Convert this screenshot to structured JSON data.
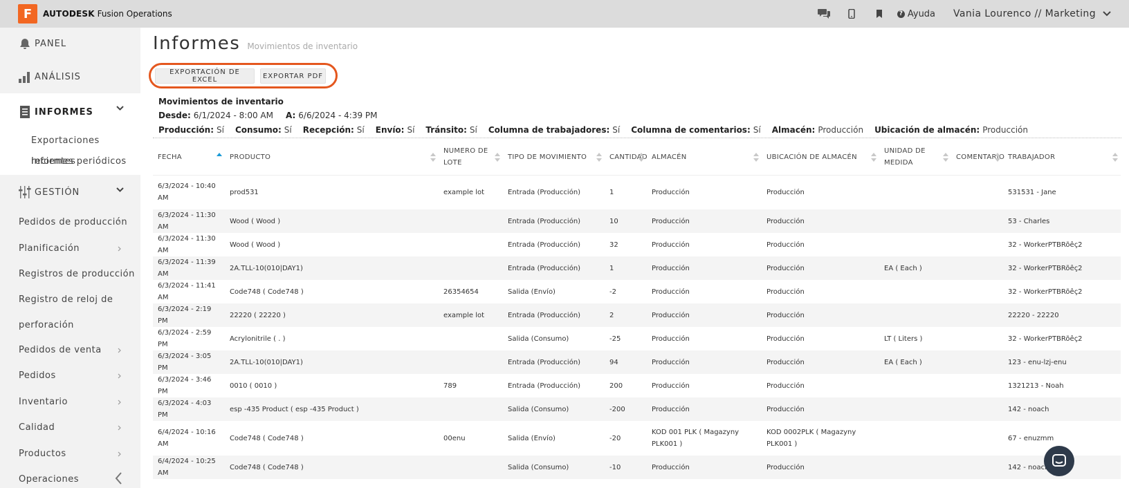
{
  "topbar": {
    "logo_letter": "F",
    "brand_bold": "AUTODESK",
    "brand_rest": "Fusion Operations",
    "help_label": "Ayuda",
    "user_label": "Vania Lourenco // Marketing",
    "icons": [
      "chat-icon",
      "mobile-icon",
      "bookmark-icon",
      "help-icon",
      "chevron-down-icon"
    ]
  },
  "sidebar": {
    "panel": "PANEL",
    "analysis": "ANÁLISIS",
    "reports": "INFORMES",
    "reports_sub": [
      "Exportaciones recientes",
      "Informes periódicos"
    ],
    "management": "GESTIÓN",
    "management_items": [
      "Pedidos de producción",
      "Planificación",
      "Registros de producción",
      "Registro de reloj de perforación",
      "Pedidos de venta",
      "Pedidos",
      "Inventario",
      "Calidad",
      "Productos",
      "Operaciones"
    ]
  },
  "page": {
    "title": "Informes",
    "subtitle": "Movimientos de inventario",
    "btn_excel": "EXPORTACIÓN DE EXCEL",
    "btn_pdf": "EXPORTAR PDF"
  },
  "report": {
    "title": "Movimientos de inventario",
    "from_label": "Desde:",
    "from_value": "6/1/2024 - 8:00 AM",
    "to_label": "A:",
    "to_value": "6/6/2024 - 4:39 PM",
    "params": [
      {
        "label": "Producción:",
        "value": "Sí"
      },
      {
        "label": "Consumo:",
        "value": "Sí"
      },
      {
        "label": "Recepción:",
        "value": "Sí"
      },
      {
        "label": "Envío:",
        "value": "Sí"
      },
      {
        "label": "Tránsito:",
        "value": "Sí"
      },
      {
        "label": "Columna de trabajadores:",
        "value": "Sí"
      },
      {
        "label": "Columna de comentarios:",
        "value": "Sí"
      },
      {
        "label": "Almacén:",
        "value": "Producción"
      },
      {
        "label": "Ubicación de almacén:",
        "value": "Producción"
      }
    ]
  },
  "table": {
    "headers": [
      "FECHA",
      "PRODUCTO",
      "NUMERO DE LOTE",
      "TIPO DE MOVIMIENTO",
      "CANTIDAD",
      "ALMACÉN",
      "UBICACIÓN DE ALMACÉN",
      "UNIDAD DE MEDIDA",
      "COMENTARIO",
      "TRABAJADOR"
    ],
    "rows": [
      [
        "6/3/2024 - 10:40 AM",
        "prod531",
        "example lot",
        "Entrada (Producción)",
        "1",
        "Producción",
        "Producción",
        "",
        "",
        "531531 - Jane"
      ],
      [
        "6/3/2024 - 11:30 AM",
        "Wood ( Wood )",
        "",
        "Entrada (Producción)",
        "10",
        "Producción",
        "Producción",
        "",
        "",
        "53 - Charles"
      ],
      [
        "6/3/2024 - 11:30 AM",
        "Wood ( Wood )",
        "",
        "Entrada (Producción)",
        "32",
        "Producción",
        "Producción",
        "",
        "",
        "32 - WorkerPTBRõêç2"
      ],
      [
        "6/3/2024 - 11:39 AM",
        "2A.TLL-10(010|DAY1)",
        "",
        "Entrada (Producción)",
        "1",
        "Producción",
        "Producción",
        "EA ( Each )",
        "",
        "32 - WorkerPTBRõêç2"
      ],
      [
        "6/3/2024 - 11:41 AM",
        "Code748 ( Code748 )",
        "26354654",
        "Salida (Envío)",
        "-2",
        "Producción",
        "Producción",
        "",
        "",
        "32 - WorkerPTBRõêç2"
      ],
      [
        "6/3/2024 - 2:19 PM",
        "22220 ( 22220 )",
        "example lot",
        "Entrada (Producción)",
        "2",
        "Producción",
        "Producción",
        "",
        "",
        "22220 - 22220"
      ],
      [
        "6/3/2024 - 2:59 PM",
        "Acrylonitrile ( . )",
        "",
        "Salida (Consumo)",
        "-25",
        "Producción",
        "Producción",
        "LT ( Liters )",
        "",
        "32 - WorkerPTBRõêç2"
      ],
      [
        "6/3/2024 - 3:05 PM",
        "2A.TLL-10(010|DAY1)",
        "",
        "Entrada (Producción)",
        "94",
        "Producción",
        "Producción",
        "EA ( Each )",
        "",
        "123 - enu-lzj-enu"
      ],
      [
        "6/3/2024 - 3:46 PM",
        "0010 ( 0010 )",
        "789",
        "Entrada (Producción)",
        "200",
        "Producción",
        "Producción",
        "",
        "",
        "1321213 - Noah"
      ],
      [
        "6/3/2024 - 4:03 PM",
        "esp -435 Product ( esp -435 Product )",
        "",
        "Salida (Consumo)",
        "-200",
        "Producción",
        "Producción",
        "",
        "",
        "142 - noach"
      ],
      [
        "6/4/2024 - 10:16 AM",
        "Code748 ( Code748 )",
        "00enu",
        "Salida (Envío)",
        "-20",
        "KOD 001 PLK ( Magazyny PLK001 )",
        "KOD 0002PLK ( Magazyny PLK001 )",
        "",
        "",
        "67 - enuzmm"
      ],
      [
        "6/4/2024 - 10:25 AM",
        "Code748 ( Code748 )",
        "",
        "Salida (Consumo)",
        "-10",
        "Producción",
        "Producción",
        "",
        "",
        "142 - noach"
      ]
    ]
  },
  "colors": {
    "accent": "#f26722",
    "highlight_ring": "#e4571e",
    "sort_active": "#1a9ad6",
    "fab": "#2e3a4a"
  }
}
